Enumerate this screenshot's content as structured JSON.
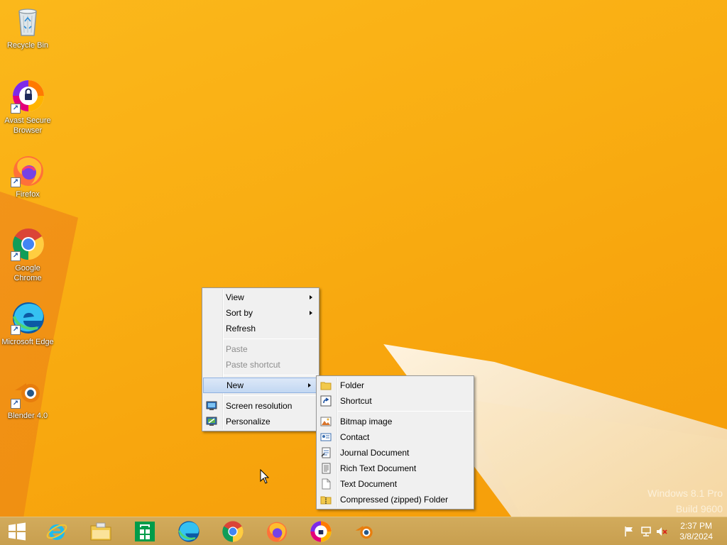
{
  "desktop": {
    "icons": [
      {
        "label": "Recycle Bin",
        "icon": "recycle-bin-icon"
      },
      {
        "label": "Avast Secure Browser",
        "icon": "avast-browser-icon"
      },
      {
        "label": "Firefox",
        "icon": "firefox-icon"
      },
      {
        "label": "Google Chrome",
        "icon": "chrome-icon"
      },
      {
        "label": "Microsoft Edge",
        "icon": "edge-icon"
      },
      {
        "label": "Blender 4.0",
        "icon": "blender-icon"
      }
    ]
  },
  "context_menu": {
    "items": [
      {
        "label": "View"
      },
      {
        "label": "Sort by"
      },
      {
        "label": "Refresh"
      },
      {
        "label": "Paste"
      },
      {
        "label": "Paste shortcut"
      },
      {
        "label": "New"
      },
      {
        "label": "Screen resolution"
      },
      {
        "label": "Personalize"
      }
    ]
  },
  "new_submenu": {
    "items": [
      {
        "label": "Folder",
        "icon": "folder-icon"
      },
      {
        "label": "Shortcut",
        "icon": "shortcut-icon"
      },
      {
        "label": "Bitmap image",
        "icon": "bitmap-icon"
      },
      {
        "label": "Contact",
        "icon": "contact-icon"
      },
      {
        "label": "Journal Document",
        "icon": "journal-icon"
      },
      {
        "label": "Rich Text Document",
        "icon": "rich-text-icon"
      },
      {
        "label": "Text Document",
        "icon": "text-document-icon"
      },
      {
        "label": "Compressed (zipped) Folder",
        "icon": "zip-folder-icon"
      }
    ]
  },
  "watermark": {
    "line1": "Windows 8.1 Pro",
    "line2": "Build 9600"
  },
  "taskbar": {
    "pinned": [
      "internet-explorer-icon",
      "file-explorer-icon",
      "store-icon",
      "edge-icon",
      "chrome-icon",
      "firefox-icon",
      "avast-browser-icon",
      "blender-icon"
    ],
    "clock": {
      "time": "2:37 PM",
      "date": "3/8/2024"
    }
  },
  "colors": {
    "wallpaper": "#f9ad12",
    "taskbar": "#cba352",
    "menu_bg": "#f0f0f0",
    "menu_highlight": "#c9dcf5"
  }
}
